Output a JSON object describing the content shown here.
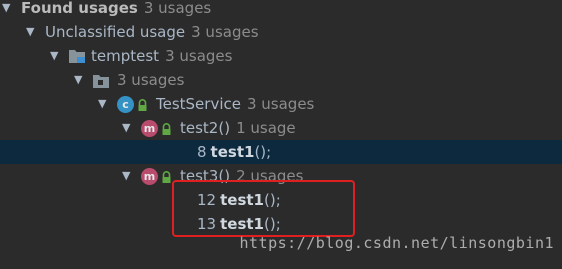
{
  "tree": {
    "root": {
      "label": "Found usages",
      "count": "3 usages"
    },
    "category": {
      "label": "Unclassified usage",
      "count": "3 usages"
    },
    "module": {
      "label": "temptest",
      "count": "3 usages",
      "icon": "module-folder-icon"
    },
    "package": {
      "label": "",
      "count": "3 usages",
      "icon": "package-folder-icon"
    },
    "class": {
      "label": "TestService",
      "count": "3 usages",
      "icon": "class-c-icon",
      "visibility_icon": "lock-icon"
    },
    "methods": [
      {
        "label": "test2()",
        "count": "1 usage",
        "icon": "method-m-icon",
        "usages": [
          {
            "line": "8",
            "call": "test1",
            "suffix": "();",
            "selected": true
          }
        ]
      },
      {
        "label": "test3()",
        "count": "2 usages",
        "icon": "method-m-icon",
        "usages": [
          {
            "line": "12",
            "call": "test1",
            "suffix": "();",
            "selected": false
          },
          {
            "line": "13",
            "call": "test1",
            "suffix": "();",
            "selected": false
          }
        ]
      }
    ]
  },
  "watermark": "https://blog.csdn.net/linsongbin1",
  "colors": {
    "background": "#2b2b2b",
    "selection": "#0d293e",
    "text": "#a9b7c6",
    "count": "#8c8c8c",
    "class_icon": "#3592c4",
    "method_icon": "#b94b6d",
    "annotation_box": "#e02020"
  }
}
